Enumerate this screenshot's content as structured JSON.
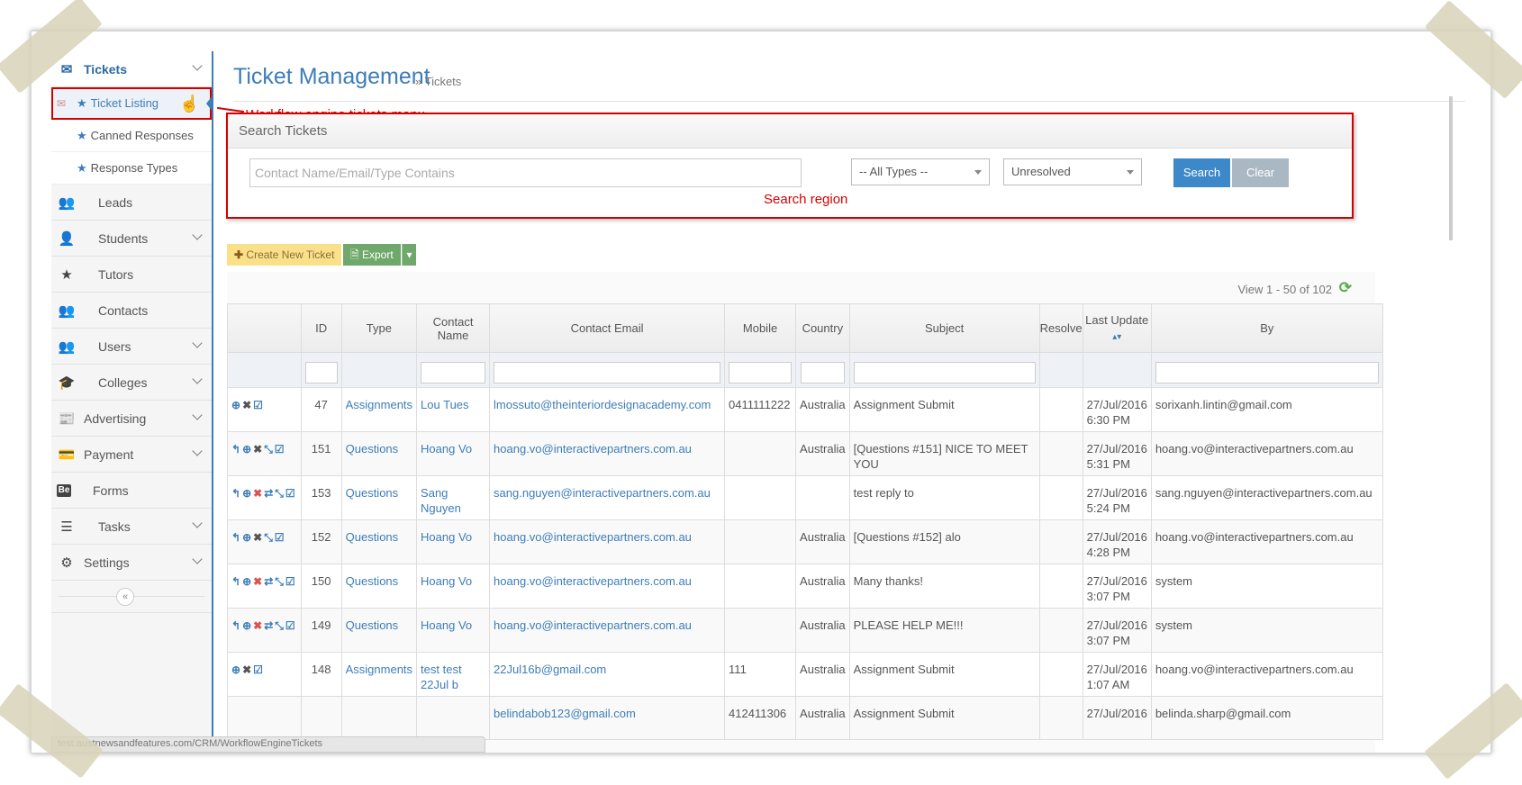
{
  "sidebar": {
    "top": {
      "label": "Tickets",
      "icon": "envelope-icon"
    },
    "subitems": [
      {
        "label": "Ticket Listing",
        "icon": "star-icon",
        "active": true
      },
      {
        "label": "Canned Responses",
        "icon": "star-icon"
      },
      {
        "label": "Response Types",
        "icon": "star-icon"
      }
    ],
    "items": [
      {
        "label": "Leads",
        "icon": "group-icon",
        "glyph": "👥",
        "chevron": false
      },
      {
        "label": "Students",
        "icon": "user-icon",
        "glyph": "👤",
        "chevron": true
      },
      {
        "label": "Tutors",
        "icon": "star-icon",
        "glyph": "★",
        "chevron": false
      },
      {
        "label": "Contacts",
        "icon": "group-icon",
        "glyph": "👥",
        "chevron": false
      },
      {
        "label": "Users",
        "icon": "group-icon",
        "glyph": "👥",
        "chevron": true
      },
      {
        "label": "Colleges",
        "icon": "graduation-cap-icon",
        "glyph": "🎓",
        "chevron": true
      },
      {
        "label": "Advertising",
        "icon": "newspaper-icon",
        "glyph": "📰",
        "chevron": true
      },
      {
        "label": "Payment",
        "icon": "credit-card-icon",
        "glyph": "💳",
        "chevron": true
      },
      {
        "label": "Forms",
        "icon": "behance-icon",
        "glyph": "Be",
        "chevron": false
      },
      {
        "label": "Tasks",
        "icon": "tasks-icon",
        "glyph": "☰",
        "chevron": true
      },
      {
        "label": "Settings",
        "icon": "gears-icon",
        "glyph": "⚙",
        "chevron": true
      }
    ],
    "collapse": "«"
  },
  "header": {
    "title": "Ticket Management",
    "breadcrumb": "» Tickets"
  },
  "annotations": {
    "menu": "Workflow engine tickets menu",
    "search": "Search region"
  },
  "search": {
    "title": "Search Tickets",
    "placeholder": "Contact Name/Email/Type Contains",
    "type_select": "-- All Types --",
    "status_select": "Unresolved",
    "search_label": "Search",
    "clear_label": "Clear"
  },
  "toolbar": {
    "create_label": "Create New Ticket",
    "export_label": "Export"
  },
  "grid": {
    "view_info": "View 1 - 50 of 102",
    "columns": [
      "",
      "ID",
      "Type",
      "Contact Name",
      "Contact Email",
      "Mobile",
      "Country",
      "Subject",
      "Resolve",
      "Last Update",
      "By"
    ],
    "rows": [
      {
        "actions": [
          "view",
          "close",
          "check"
        ],
        "id": "47",
        "type": "Assignments",
        "name": "Lou Tues",
        "email": "lmossuto@theinteriordesignacademy.com",
        "mobile": "0411111222",
        "country": "Australia",
        "subject": "Assignment Submit",
        "resolve": "",
        "date": "27/Jul/2016",
        "time": "6:30 PM",
        "by": "sorixanh.lintin@gmail.com"
      },
      {
        "actions": [
          "reply",
          "view",
          "close",
          "merge",
          "check"
        ],
        "id": "151",
        "type": "Questions",
        "name": "Hoang Vo",
        "email": "hoang.vo@interactivepartners.com.au",
        "mobile": "",
        "country": "Australia",
        "subject": "[Questions #151] NICE TO MEET YOU",
        "resolve": "",
        "date": "27/Jul/2016",
        "time": "5:31 PM",
        "by": "hoang.vo@interactivepartners.com.au"
      },
      {
        "actions": [
          "reply",
          "view",
          "close-red",
          "transfer",
          "merge",
          "check"
        ],
        "id": "153",
        "type": "Questions",
        "name": "Sang Nguyen",
        "email": "sang.nguyen@interactivepartners.com.au",
        "mobile": "",
        "country": "",
        "subject": "test reply to",
        "resolve": "",
        "date": "27/Jul/2016",
        "time": "5:24 PM",
        "by": "sang.nguyen@interactivepartners.com.au"
      },
      {
        "actions": [
          "reply",
          "view",
          "close",
          "merge",
          "check"
        ],
        "id": "152",
        "type": "Questions",
        "name": "Hoang Vo",
        "email": "hoang.vo@interactivepartners.com.au",
        "mobile": "",
        "country": "Australia",
        "subject": "[Questions #152] alo",
        "resolve": "",
        "date": "27/Jul/2016",
        "time": "4:28 PM",
        "by": "hoang.vo@interactivepartners.com.au"
      },
      {
        "actions": [
          "reply",
          "view",
          "close-red",
          "transfer",
          "merge",
          "check"
        ],
        "id": "150",
        "type": "Questions",
        "name": "Hoang Vo",
        "email": "hoang.vo@interactivepartners.com.au",
        "mobile": "",
        "country": "Australia",
        "subject": "Many thanks!",
        "resolve": "",
        "date": "27/Jul/2016",
        "time": "3:07 PM",
        "by": "system"
      },
      {
        "actions": [
          "reply",
          "view",
          "close-red",
          "transfer",
          "merge",
          "check"
        ],
        "id": "149",
        "type": "Questions",
        "name": "Hoang Vo",
        "email": "hoang.vo@interactivepartners.com.au",
        "mobile": "",
        "country": "Australia",
        "subject": "PLEASE HELP ME!!!",
        "resolve": "",
        "date": "27/Jul/2016",
        "time": "3:07 PM",
        "by": "system"
      },
      {
        "actions": [
          "view",
          "close",
          "check"
        ],
        "id": "148",
        "type": "Assignments",
        "name": "test test 22Jul b",
        "email": "22Jul16b@gmail.com",
        "mobile": "111",
        "country": "Australia",
        "subject": "Assignment Submit",
        "resolve": "",
        "date": "27/Jul/2016",
        "time": "1:07 AM",
        "by": "hoang.vo@interactivepartners.com.au"
      },
      {
        "actions": [],
        "id": "",
        "type": "",
        "name": "",
        "email": "belindabob123@gmail.com",
        "mobile": "412411306",
        "country": "Australia",
        "subject": "Assignment Submit",
        "resolve": "",
        "date": "27/Jul/2016",
        "time": "",
        "by": "belinda.sharp@gmail.com"
      }
    ]
  },
  "status_bar": "test.austnewsandfeatures.com/CRM/WorkflowEngineTickets",
  "colors": {
    "accent": "#3d7db8",
    "annotation": "#d40000",
    "search_btn": "#3d88c9",
    "clear_btn": "#aab8c4",
    "create_btn": "#fbe08a",
    "export_btn": "#6fa86a"
  }
}
